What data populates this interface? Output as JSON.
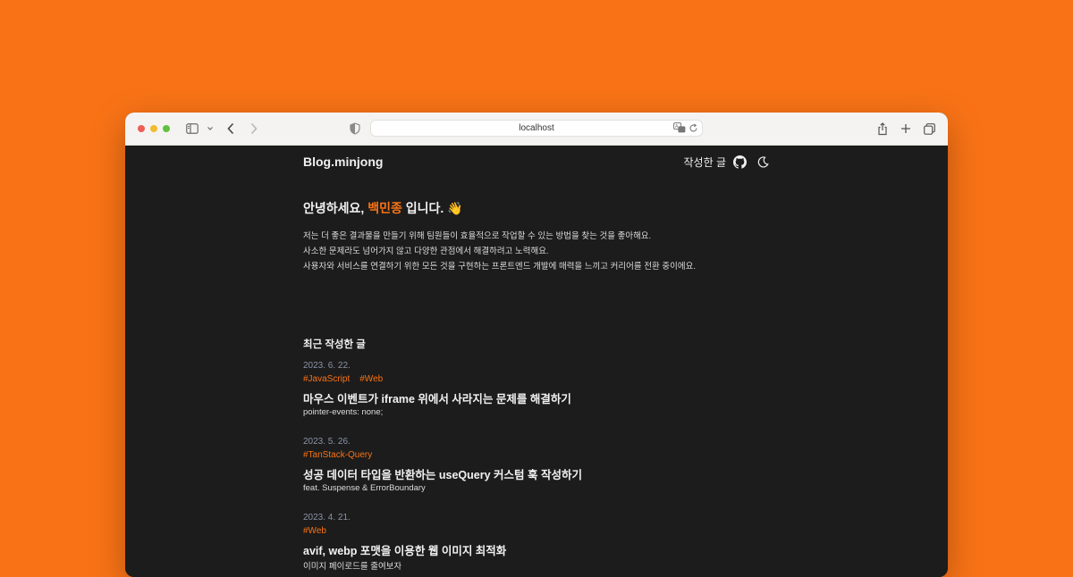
{
  "browser": {
    "url": "localhost",
    "icons": [
      "sidebar-toggle-icon",
      "chevron-down-icon",
      "back-icon",
      "forward-icon",
      "shield-icon",
      "translate-icon",
      "reload-icon",
      "share-icon",
      "new-tab-icon",
      "tabs-overview-icon"
    ]
  },
  "header": {
    "site_title": "Blog.minjong",
    "nav_link": "작성한 글",
    "icons": [
      "github-icon",
      "moon-icon"
    ]
  },
  "intro": {
    "greeting_prefix": "안녕하세요, ",
    "name": "백민종",
    "greeting_suffix": " 입니다. 👋",
    "lines": [
      "저는 더 좋은 결과물을 만들기 위해 팀원들이 효율적으로 작업할 수 있는 방법을 찾는 것을 좋아해요.",
      "사소한 문제라도 넘어가지 않고 다양한 관점에서 해결하려고 노력해요.",
      "사용자와 서비스를 연결하기 위한 모든 것을 구현하는 프론트엔드 개발에 매력을 느끼고 커리어를 전환 중이에요."
    ]
  },
  "recent": {
    "title": "최근 작성한 글",
    "posts": [
      {
        "date": "2023. 6. 22.",
        "tags": [
          "#JavaScript",
          "#Web"
        ],
        "title": "마우스 이벤트가 iframe 위에서 사라지는 문제를 해결하기",
        "desc": "pointer-events: none;"
      },
      {
        "date": "2023. 5. 26.",
        "tags": [
          "#TanStack-Query"
        ],
        "title": "성공 데이터 타입을 반환하는 useQuery 커스텀 훅 작성하기",
        "desc": "feat. Suspense & ErrorBoundary"
      },
      {
        "date": "2023. 4. 21.",
        "tags": [
          "#Web"
        ],
        "title": "avif, webp 포맷을 이용한 웹 이미지 최적화",
        "desc": "이미지 페이로드를 줄여보자"
      }
    ]
  },
  "colors": {
    "background": "#f97316",
    "accent": "#f97316",
    "page_bg": "#1c1c1c",
    "date": "#8a93a6"
  }
}
